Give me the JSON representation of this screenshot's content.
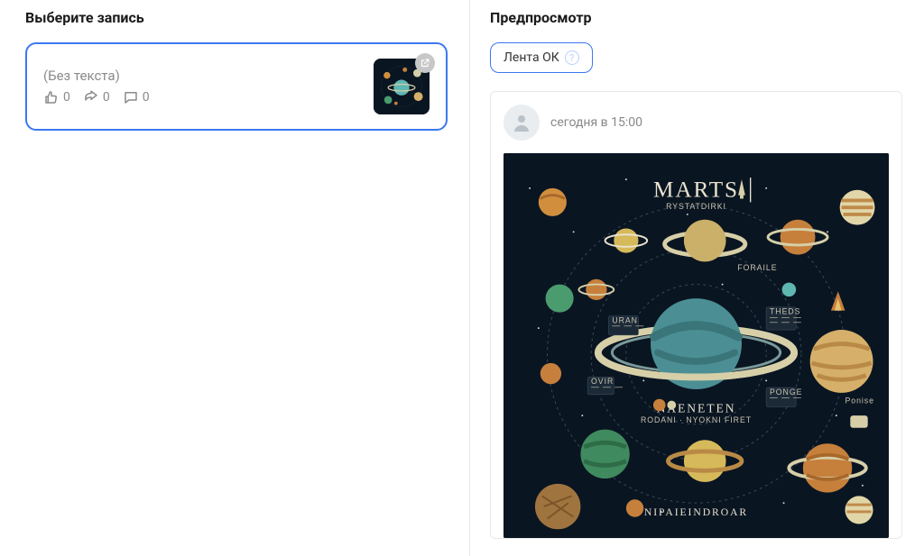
{
  "left": {
    "title": "Выберите запись",
    "record": {
      "placeholder": "(Без текста)",
      "likes": "0",
      "shares": "0",
      "comments": "0"
    }
  },
  "right": {
    "title": "Предпросмотр",
    "chip_label": "Лента ОК",
    "post": {
      "timestamp": "сегодня в 15:00"
    }
  },
  "illustration": {
    "title": "MARTS",
    "label_center": "NAENETEN",
    "label_bottom": "NIPAIEINDROAR",
    "small1": "FORAILE"
  }
}
